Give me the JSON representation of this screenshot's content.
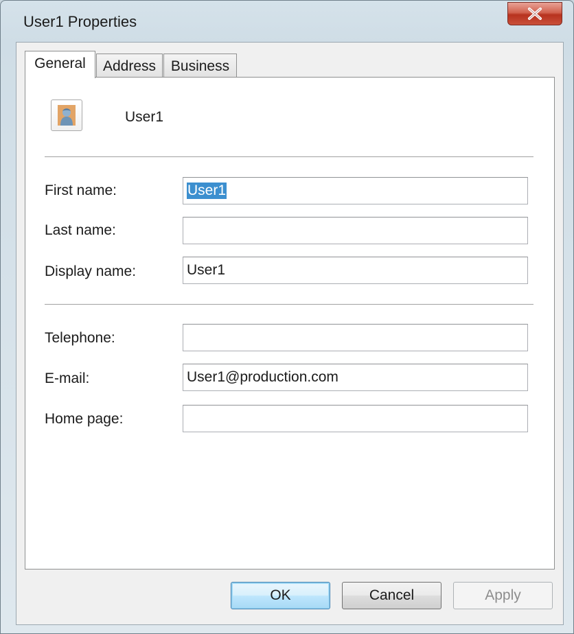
{
  "window": {
    "title": "User1 Properties"
  },
  "tabs": [
    {
      "label": "General",
      "active": true
    },
    {
      "label": "Address",
      "active": false
    },
    {
      "label": "Business",
      "active": false
    }
  ],
  "general": {
    "user_display": "User1",
    "fields_top": [
      {
        "label": "First name:",
        "value": "User1",
        "selected": true
      },
      {
        "label": "Last name:",
        "value": ""
      },
      {
        "label": "Display name:",
        "value": "User1"
      }
    ],
    "fields_bottom": [
      {
        "label": "Telephone:",
        "value": ""
      },
      {
        "label": "E-mail:",
        "value": "User1@production.com"
      },
      {
        "label": "Home page:",
        "value": ""
      }
    ]
  },
  "buttons": {
    "ok": "OK",
    "cancel": "Cancel",
    "apply": "Apply"
  },
  "icons": {
    "close": "close-icon",
    "user": "user-icon"
  },
  "colors": {
    "selection": "#3c8fcf",
    "close_button": "#c9503a",
    "default_button_border": "#3c7fb1"
  }
}
